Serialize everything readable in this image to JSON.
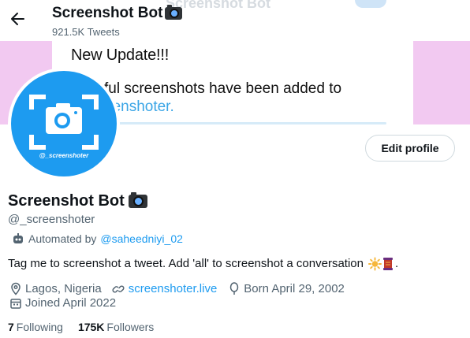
{
  "header": {
    "title": "Screenshot Bot",
    "tweet_count": "921.5K Tweets",
    "back_icon": "arrow-left-icon"
  },
  "banner": {
    "ghost_text": "Screenshot Bot",
    "headline": "New Update!!!",
    "line2": "ful screenshots have been added to",
    "line3": "eenshoter."
  },
  "avatar": {
    "handle_text": "@_screenshoter",
    "bg_color": "#1d9bf0"
  },
  "profile": {
    "edit_button": "Edit profile",
    "display_name": "Screenshot Bot",
    "username": "@_screenshoter",
    "automated_prefix": "Automated by",
    "automated_link": "@saheedniyi_02",
    "bio_text": "Tag me to screenshot a tweet. Add 'all' to screenshot a conversation",
    "bio_end": ".",
    "location": "Lagos, Nigeria",
    "website": "screenshoter.live",
    "birthday": "Born April 29, 2002",
    "joined": "Joined April 2022",
    "following_count": "7",
    "following_label": "Following",
    "followers_count": "175K",
    "followers_label": "Followers"
  },
  "colors": {
    "accent": "#1d9bf0",
    "secondary_text": "#536471",
    "banner_pink": "#f2c9f1"
  }
}
